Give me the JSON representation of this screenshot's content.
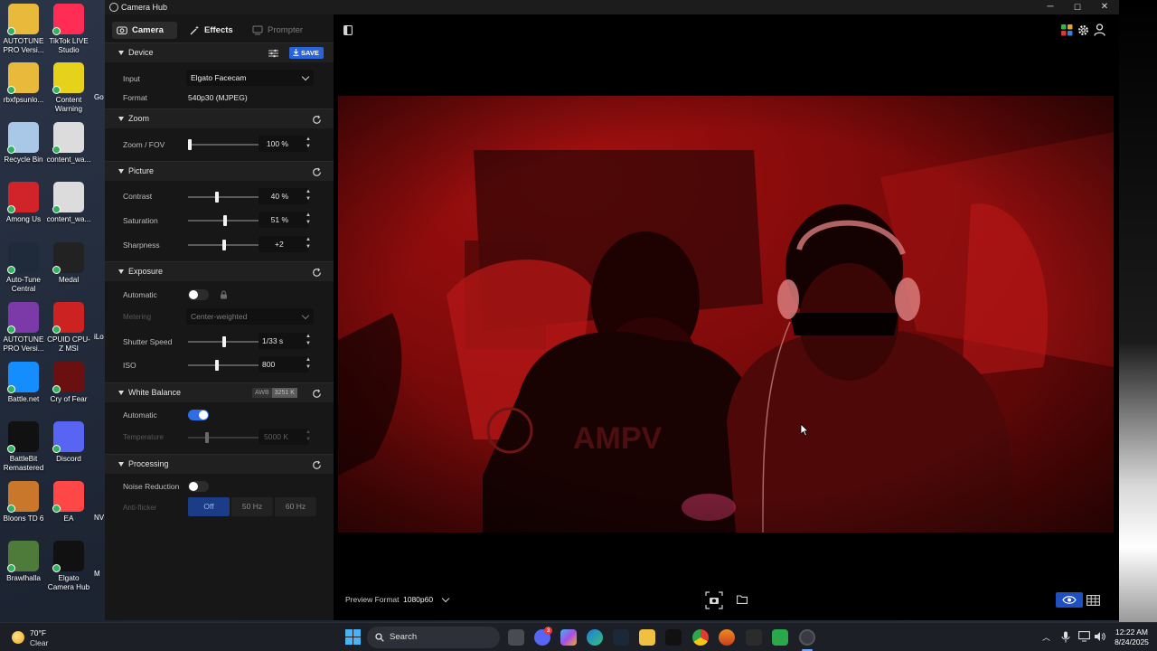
{
  "window": {
    "title": "Camera Hub",
    "controls": {
      "minimize": "─",
      "maximize": "☐",
      "close": "✕"
    }
  },
  "tabs": [
    {
      "label": "Camera",
      "state": "active"
    },
    {
      "label": "Effects",
      "state": "normal"
    },
    {
      "label": "Prompter",
      "state": "muted"
    }
  ],
  "device": {
    "title": "Device",
    "save_label": "SAVE",
    "input_label": "Input",
    "input_value": "Elgato Facecam",
    "format_label": "Format",
    "format_value": "540p30 (MJPEG)"
  },
  "zoom": {
    "title": "Zoom",
    "fov_label": "Zoom / FOV",
    "fov_value": "100 %",
    "fov_level": 0.0
  },
  "picture": {
    "title": "Picture",
    "contrast_label": "Contrast",
    "contrast_value": "40 %",
    "contrast_level": 0.4,
    "saturation_label": "Saturation",
    "saturation_value": "51 %",
    "saturation_level": 0.51,
    "sharpness_label": "Sharpness",
    "sharpness_value": "+2",
    "sharpness_level": 0.5
  },
  "exposure": {
    "title": "Exposure",
    "auto_label": "Automatic",
    "auto_on": false,
    "metering_label": "Metering",
    "metering_value": "Center-weighted",
    "shutter_label": "Shutter Speed",
    "shutter_value": "1/33 s",
    "shutter_level": 0.5,
    "iso_label": "ISO",
    "iso_value": "800",
    "iso_level": 0.4
  },
  "white_balance": {
    "title": "White Balance",
    "badge_mode": "AWB",
    "badge_kelvin": "3251 K",
    "auto_label": "Automatic",
    "auto_on": true,
    "temperature_label": "Temperature",
    "temperature_value": "5000 K",
    "temperature_level": 0.25
  },
  "processing": {
    "title": "Processing",
    "noise_label": "Noise Reduction",
    "noise_on": false,
    "antiflicker_label": "Anti-flicker",
    "antiflicker_options": [
      "Off",
      "50 Hz",
      "60 Hz"
    ],
    "antiflicker_selected": "Off"
  },
  "preview": {
    "format_label": "Preview Format",
    "format_value": "1080p60"
  },
  "desktop_icons": [
    {
      "label": "AUTOTUNE PRO Versi...",
      "icon": "folder-icon",
      "color": "#e8b93a"
    },
    {
      "label": "TikTok LIVE Studio",
      "icon": "tiktok-icon",
      "color": "#ff2d55"
    },
    {
      "label": "rbxfpsunlo...",
      "icon": "folder-icon",
      "color": "#e8b93a"
    },
    {
      "label": "Content Warning",
      "icon": "eye-icon",
      "color": "#e6d21b"
    },
    {
      "label": "Recycle Bin",
      "icon": "recycle-bin-icon",
      "color": "#a9c8e8"
    },
    {
      "label": "content_wa...",
      "icon": "video-file-icon",
      "color": "#dcdcdc"
    },
    {
      "label": "Among Us",
      "icon": "among-us-icon",
      "color": "#d1232a"
    },
    {
      "label": "content_wa...",
      "icon": "video-file-icon",
      "color": "#dcdcdc"
    },
    {
      "label": "Auto-Tune Central",
      "icon": "autotune-icon",
      "color": "#1f2b3a"
    },
    {
      "label": "Medal",
      "icon": "medal-icon",
      "color": "#222"
    },
    {
      "label": "AUTOTUNE PRO Versi...",
      "icon": "winrar-icon",
      "color": "#7b3aa8"
    },
    {
      "label": "CPUID CPU-Z MSI",
      "icon": "cpuz-icon",
      "color": "#c22"
    },
    {
      "label": "Battle.net",
      "icon": "battlenet-icon",
      "color": "#148eff"
    },
    {
      "label": "Cry of Fear",
      "icon": "cry-of-fear-icon",
      "color": "#6b1010"
    },
    {
      "label": "BattleBit Remastered",
      "icon": "battlebit-icon",
      "color": "#111"
    },
    {
      "label": "Discord",
      "icon": "discord-icon",
      "color": "#5865f2"
    },
    {
      "label": "Bloons TD 6",
      "icon": "bloons-icon",
      "color": "#c9772a"
    },
    {
      "label": "EA",
      "icon": "ea-icon",
      "color": "#ff4747"
    },
    {
      "label": "Brawlhalla",
      "icon": "brawlhalla-icon",
      "color": "#4e7a3a"
    },
    {
      "label": "Elgato Camera Hub",
      "icon": "camera-hub-icon",
      "color": "#111"
    }
  ],
  "desktop_partial_labels": [
    "Go Ga",
    "iLo",
    "M",
    "NV"
  ],
  "taskbar": {
    "weather_temp": "70°F",
    "weather_text": "Clear",
    "search_placeholder": "Search",
    "time": "12:22 AM",
    "date": "8/24/2025",
    "discord_badge": "3"
  }
}
